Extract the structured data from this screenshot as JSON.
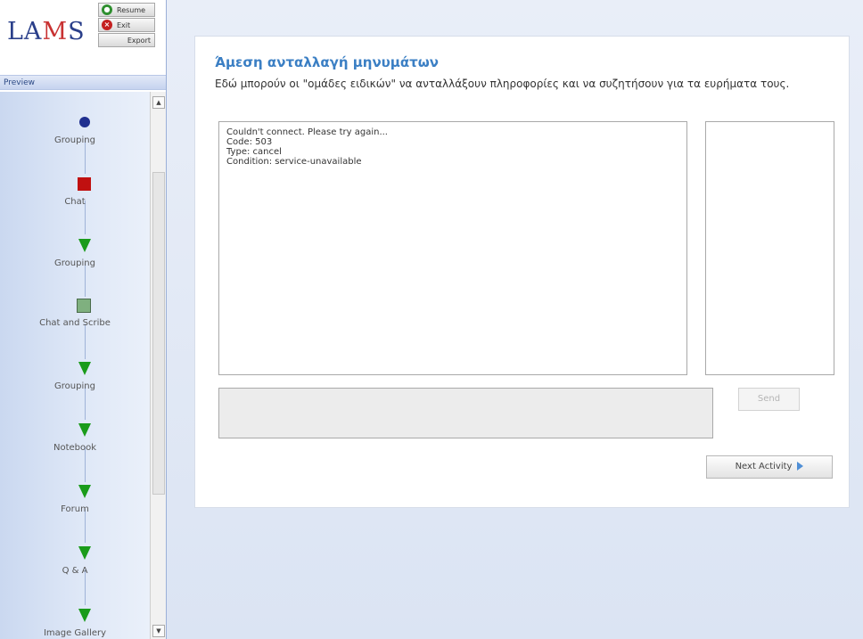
{
  "sidebar": {
    "logo": "LAMS",
    "controls": {
      "resume": "Resume",
      "exit": "Exit",
      "export": "Export"
    },
    "panel_title": "Preview",
    "sequence": [
      {
        "label": "Grouping",
        "marker": "blue-circle"
      },
      {
        "label": "Chat",
        "marker": "red-square"
      },
      {
        "label": "Grouping",
        "marker": "green-triangle"
      },
      {
        "label": "Chat and Scribe",
        "marker": "green-box"
      },
      {
        "label": "Grouping",
        "marker": "green-triangle"
      },
      {
        "label": "Notebook",
        "marker": "green-triangle"
      },
      {
        "label": "Forum",
        "marker": "green-triangle"
      },
      {
        "label": "Q & A",
        "marker": "green-triangle"
      },
      {
        "label": "Image Gallery",
        "marker": "green-triangle"
      }
    ]
  },
  "main": {
    "title": "Άμεση ανταλλαγή μηνυμάτων",
    "description": "Εδώ μπορούν οι \"ομάδες ειδικών\" να ανταλλάξουν πληροφορίες και να συζητήσουν για τα ευρήματα τους.",
    "messages": [
      "Couldn't connect. Please try again...",
      "Code: 503",
      "Type: cancel",
      "Condition: service-unavailable"
    ],
    "send_label": "Send",
    "next_label": "Next Activity"
  },
  "colors": {
    "title_blue": "#3b7fc4",
    "sidebar_bg": "#cad8f0",
    "complete_green": "#1a9b1a",
    "current_red": "#c01010",
    "attempted_blue": "#1f2f8f"
  }
}
